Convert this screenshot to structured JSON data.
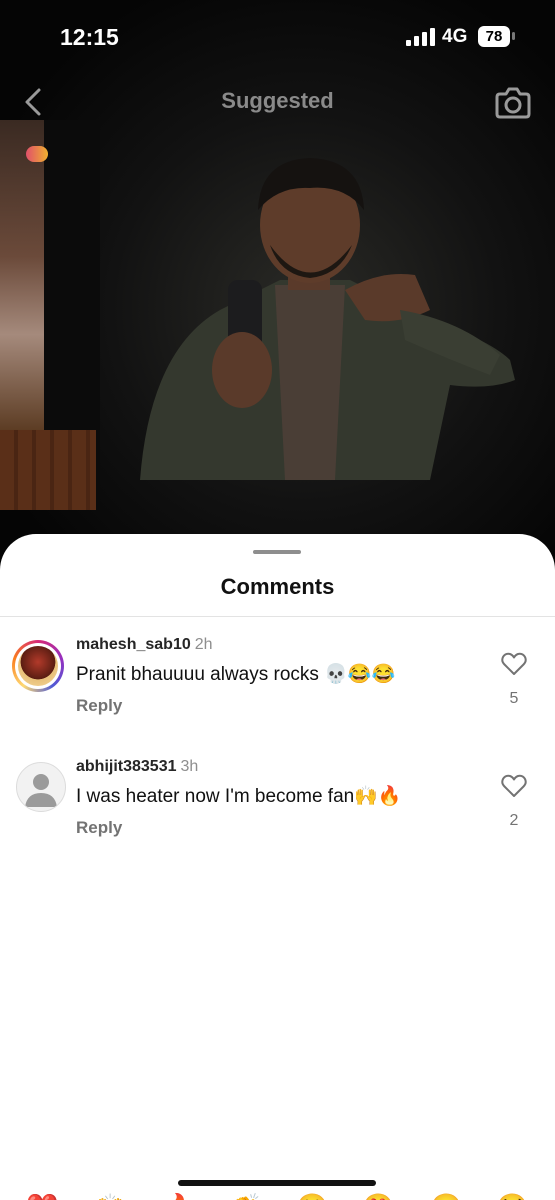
{
  "status_bar": {
    "time": "12:15",
    "network": "4G",
    "battery": "78"
  },
  "header": {
    "title": "Suggested",
    "back_icon": "chevron-left-icon",
    "camera_icon": "camera-icon"
  },
  "comments_sheet": {
    "title": "Comments",
    "comments": [
      {
        "username": "mahesh_sab10",
        "time": "2h",
        "text": "Pranit bhauuuu always rocks 💀😂😂",
        "reply_label": "Reply",
        "likes": "5",
        "avatar": "story-ring-avatar"
      },
      {
        "username": "abhijit383531",
        "time": "3h",
        "text": "I was heater now I'm become fan🙌🔥",
        "reply_label": "Reply",
        "likes": "2",
        "avatar": "default-avatar"
      }
    ]
  },
  "emoji_bar": [
    "❤️",
    "🙌",
    "🔥",
    "👏",
    "😢",
    "😍",
    "😮",
    "😂"
  ],
  "colors": {
    "sheet_bg": "#ffffff",
    "muted_text": "#737373",
    "story_ring": "#d62976"
  }
}
